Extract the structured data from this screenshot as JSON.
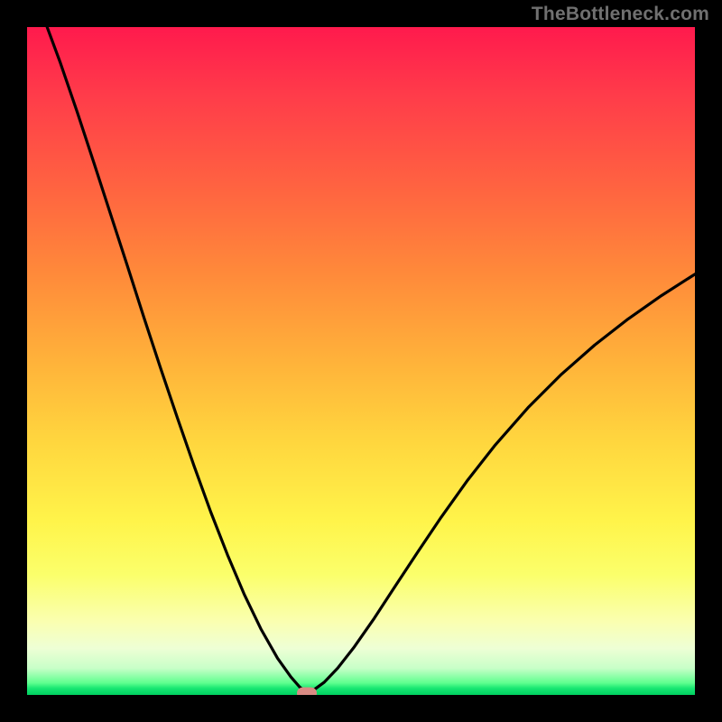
{
  "watermark": "TheBottleneck.com",
  "colors": {
    "frame": "#000000",
    "curve": "#000000",
    "marker": "#d98a83",
    "gradient_top": "#ff1a4d",
    "gradient_bottom": "#00d060"
  },
  "chart_data": {
    "type": "line",
    "title": "",
    "xlabel": "",
    "ylabel": "",
    "xlim": [
      0,
      100
    ],
    "ylim": [
      0,
      100
    ],
    "grid": false,
    "legend": false,
    "optimum_x": 41.9,
    "series": [
      {
        "name": "bottleneck-curve",
        "x": [
          3.0,
          5.0,
          7.5,
          10.0,
          12.5,
          15.0,
          17.5,
          20.0,
          22.5,
          25.0,
          27.5,
          30.0,
          32.5,
          35.0,
          37.5,
          39.5,
          40.8,
          41.9,
          43.0,
          44.5,
          46.5,
          49.0,
          52.0,
          55.0,
          58.5,
          62.0,
          66.0,
          70.0,
          75.0,
          80.0,
          85.0,
          90.0,
          95.0,
          100.0
        ],
        "values": [
          100.0,
          94.6,
          87.3,
          79.7,
          72.0,
          64.3,
          56.5,
          48.9,
          41.5,
          34.3,
          27.4,
          21.0,
          15.1,
          9.9,
          5.5,
          2.7,
          1.2,
          0.3,
          0.8,
          1.9,
          4.0,
          7.2,
          11.5,
          16.1,
          21.4,
          26.6,
          32.2,
          37.3,
          43.0,
          48.0,
          52.4,
          56.3,
          59.8,
          63.0
        ]
      }
    ],
    "marker": {
      "x": 41.9,
      "y": 0.3
    }
  }
}
